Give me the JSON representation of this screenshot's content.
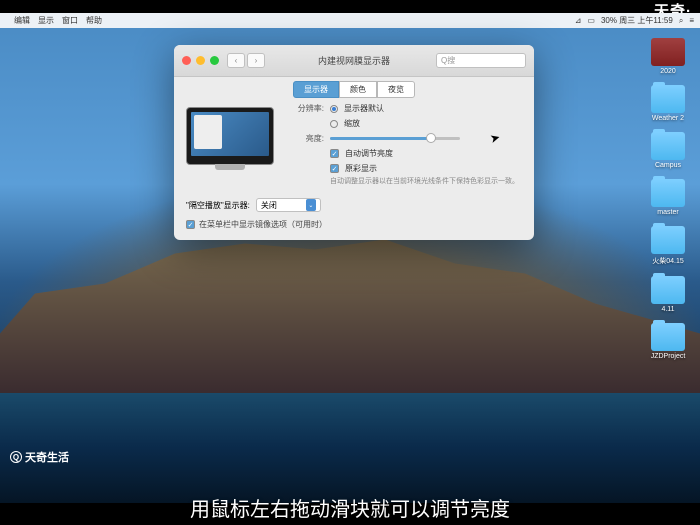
{
  "brand_top": "天奇·",
  "brand_bottom": "天奇生活",
  "caption": "用鼠标左右拖动滑块就可以调节亮度",
  "menubar": {
    "items": [
      "编辑",
      "显示",
      "窗口",
      "帮助"
    ],
    "right_status": "30%  周三 上午11:59"
  },
  "desktop": [
    {
      "type": "red",
      "label": "2020"
    },
    {
      "type": "folder",
      "label": "Weather 2"
    },
    {
      "type": "folder",
      "label": "Campus"
    },
    {
      "type": "folder",
      "label": "master"
    },
    {
      "type": "folder",
      "label": "火柴04.15"
    },
    {
      "type": "folder",
      "label": "4.11"
    },
    {
      "type": "folder",
      "label": "JZDProject"
    }
  ],
  "window": {
    "title": "内建视网膜显示器",
    "search_placeholder": "Q搜",
    "tabs": [
      "显示器",
      "颜色",
      "夜览"
    ],
    "resolution_label": "分辨率:",
    "resolution_options": [
      "显示器默认",
      "缩放"
    ],
    "brightness_label": "亮度:",
    "auto_brightness": "自动调节亮度",
    "truetone": "原彩显示",
    "truetone_hint": "自动调整显示器以在当前环境光线条件下保持色彩显示一致。",
    "airplay_label": "\"隔空播放\"显示器:",
    "airplay_value": "关闭",
    "menubar_option": "在菜单栏中显示镜像选项（可用时）"
  }
}
